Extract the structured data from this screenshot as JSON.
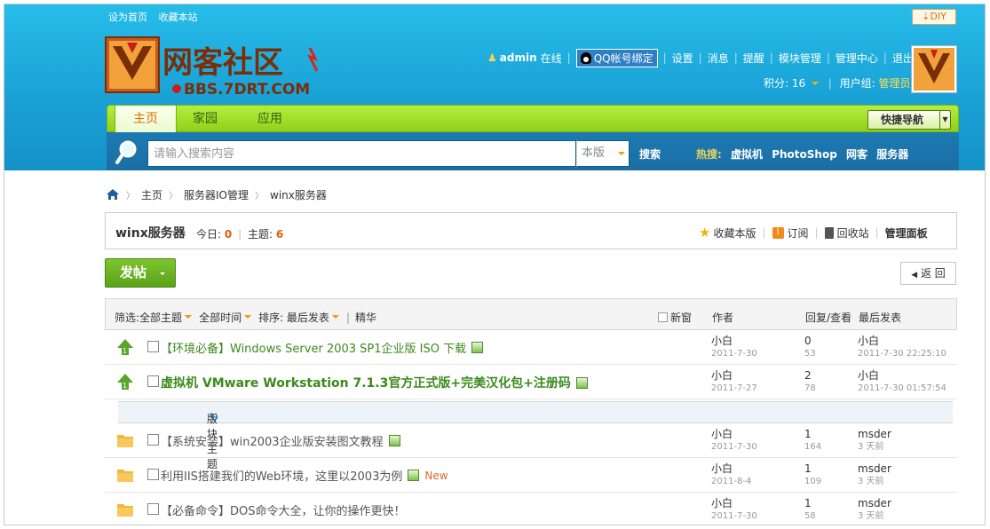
{
  "top_links": {
    "set_home": "设为首页",
    "bookmark": "收藏本站",
    "diy": "DIY"
  },
  "logo": {
    "text": "网客社区",
    "url_text": "BBS.7DRT.COM"
  },
  "user": {
    "name": "admin",
    "status": "在线",
    "qq_bind": "QQ帐号绑定",
    "links": [
      "设置",
      "消息",
      "提醒",
      "模块管理",
      "管理中心",
      "退出"
    ],
    "points_label": "积分: 16",
    "group_label": "用户组:",
    "group": "管理员"
  },
  "nav": {
    "items": [
      "主页",
      "家园",
      "应用"
    ],
    "quick_nav": "快捷导航"
  },
  "search": {
    "placeholder": "请输入搜索内容",
    "scope": "本版",
    "button": "搜索",
    "hot_label": "热搜:",
    "hot": [
      "虚拟机",
      "PhotoShop",
      "网客",
      "服务器"
    ]
  },
  "breadcrumb": [
    "主页",
    "服务器IO管理",
    "winx服务器"
  ],
  "forum": {
    "name": "winx服务器",
    "today_label": "今日:",
    "today": "0",
    "threads_label": "主题:",
    "threads": "6",
    "tools": [
      "收藏本版",
      "订阅",
      "回收站",
      "管理面板"
    ]
  },
  "actions": {
    "post": "发帖",
    "back": "返 回"
  },
  "list_header": {
    "filter_label": "筛选:",
    "all_threads": "全部主题",
    "all_time": "全部时间",
    "sort_label": "排序: 最后发表",
    "digest": "精华",
    "new_window": "新窗",
    "author": "作者",
    "replies": "回复/查看",
    "last_post": "最后发表"
  },
  "section_label": "版块主题",
  "rows": [
    {
      "title": "【环境必备】Windows Server 2003 SP1企业版 ISO 下载",
      "author": "小白",
      "date": "2011-7-30",
      "replies": "0",
      "views": "53",
      "last_user": "小白",
      "last_time": "2011-7-30 22:25:10"
    },
    {
      "title": "虚拟机 VMware Workstation 7.1.3官方正式版+完美汉化包+注册码",
      "author": "小白",
      "date": "2011-7-27",
      "replies": "2",
      "views": "78",
      "last_user": "小白",
      "last_time": "2011-7-30 01:57:54"
    },
    {
      "title": "【系统安装】win2003企业版安装图文教程",
      "author": "小白",
      "date": "2011-7-30",
      "replies": "1",
      "views": "164",
      "last_user": "msder",
      "last_time": "3 天前"
    },
    {
      "title": "利用IIS搭建我们的Web环境，这里以2003为例",
      "new_tag": "New",
      "author": "小白",
      "date": "2011-8-4",
      "replies": "1",
      "views": "109",
      "last_user": "msder",
      "last_time": "3 天前"
    },
    {
      "title": "【必备命令】DOS命令大全，让你的操作更快！",
      "author": "小白",
      "date": "2011-7-30",
      "replies": "1",
      "views": "58",
      "last_user": "msder",
      "last_time": "3 天前"
    }
  ]
}
